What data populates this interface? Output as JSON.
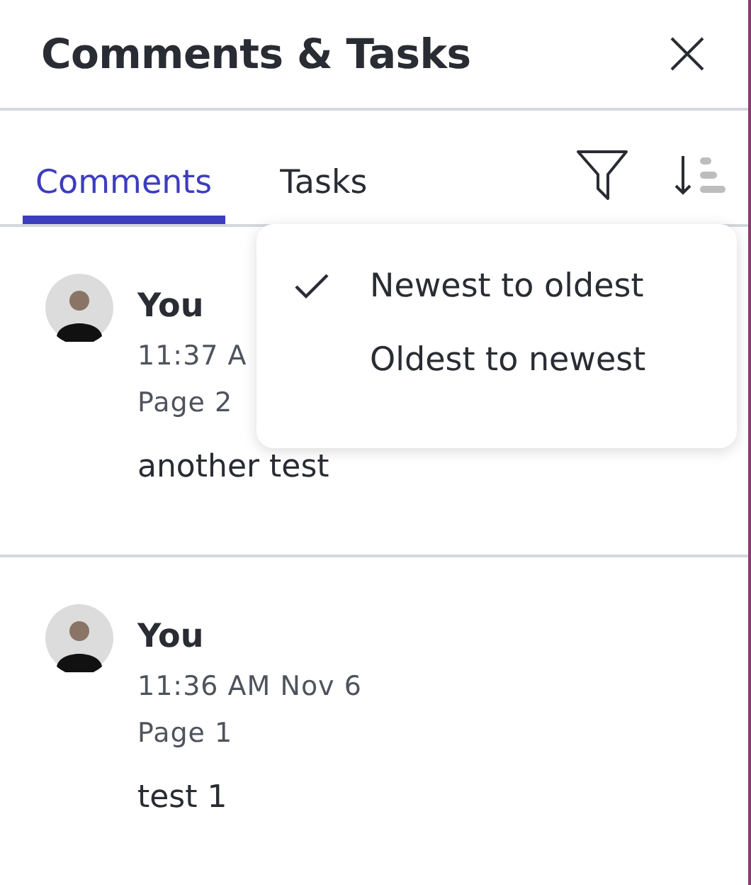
{
  "header": {
    "title": "Comments & Tasks"
  },
  "tabs": [
    {
      "label": "Comments",
      "selected": true
    },
    {
      "label": "Tasks",
      "selected": false
    }
  ],
  "comments": [
    {
      "author": "You",
      "time": "11:37 A",
      "page": "Page 2",
      "text": "another test"
    },
    {
      "author": "You",
      "time": "11:36 AM Nov 6",
      "page": "Page 1",
      "text": "test 1"
    }
  ],
  "sort_menu": {
    "items": [
      {
        "label": "Newest to oldest",
        "selected": true
      },
      {
        "label": "Oldest to newest",
        "selected": false
      }
    ]
  }
}
